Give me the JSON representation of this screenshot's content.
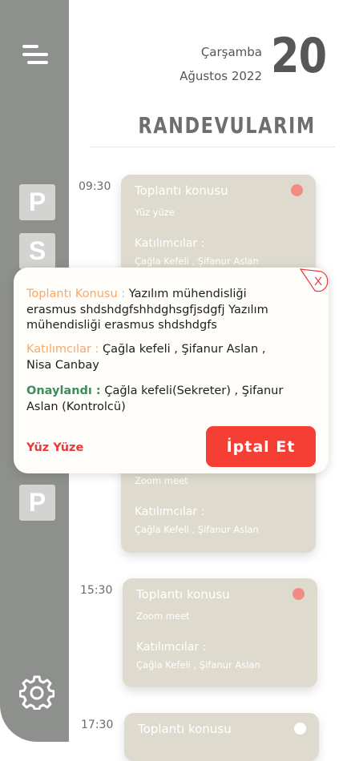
{
  "header": {
    "weekday": "Çarşamba",
    "month_year": "Ağustos 2022",
    "day": "20",
    "title": "RANDEVULARIM"
  },
  "sidebar": {
    "letters": [
      "P",
      "S",
      "P"
    ],
    "icons": [
      "menu-icon",
      "settings-icon"
    ],
    "color": "#8e908d"
  },
  "appointments": [
    {
      "time": "09:30",
      "title": "Toplantı konusu",
      "mode": "Yüz yüze",
      "participants_label": "Katılımcılar :",
      "participants": "Çağla Kefeli , Şifanur Aslan",
      "dot_color": "#f28b82"
    },
    {
      "time": "",
      "title": "",
      "mode": "Zoom meet",
      "participants_label": "Katılımcılar :",
      "participants": "Çağla Kefeli , Şifanur Aslan",
      "dot_color": ""
    },
    {
      "time": "15:30",
      "title": "Toplantı konusu",
      "mode": "Zoom meet",
      "participants_label": "Katılımcılar :",
      "participants": "Çağla Kefeli , Şifanur Aslan",
      "dot_color": "#f28b82"
    },
    {
      "time": "17:30",
      "title": "Toplantı konusu",
      "mode": "",
      "participants_label": "",
      "participants": "",
      "dot_color": "#ffffff"
    }
  ],
  "popup": {
    "close_label": "X",
    "topic_label": "Toplantı Konusu :",
    "topic_value": "Yazılım mühendisliği erasmus shdshdgfshhdghsgfjsdgfj  Yazılım mühendisliği erasmus shdshdgfs",
    "participants_label": "Katılımcılar :",
    "participants_value": "Çağla kefeli , Şifanur Aslan , Nisa Canbay",
    "approved_label": "Onaylandı :",
    "approved_value": "Çağla kefeli(Sekreter) , Şifanur Aslan (Kontrolcü)",
    "mode": "Yüz Yüze",
    "cancel_label": "İptal Et"
  },
  "colors": {
    "accent_red": "#f53e34",
    "label_orange": "#f6a96a",
    "label_green": "#3c8c5c",
    "card_bg": "#dedbce"
  }
}
